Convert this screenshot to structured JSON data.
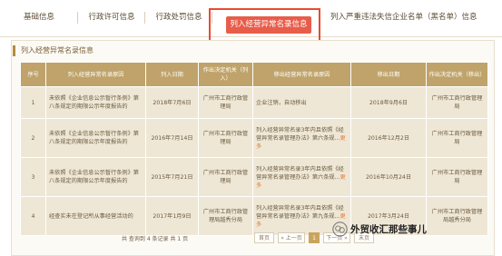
{
  "tabs": [
    {
      "label": "基础信息"
    },
    {
      "label": "行政许可信息"
    },
    {
      "label": "行政处罚信息"
    },
    {
      "label": "列入经营异常名录信息"
    },
    {
      "label": "列入严重违法失信企业名单（黑名单）信息"
    }
  ],
  "active_tab": 3,
  "section_title": "列入经营异常名录信息",
  "table": {
    "headers": [
      "序号",
      "列入经营异常名录原因",
      "列入日期",
      "作出决定机关（列入）",
      "移出经营异常名录原因",
      "移出日期",
      "作出决定机关（移出）"
    ],
    "rows": [
      {
        "no": "1",
        "reason": "未依照《企业信息公示暂行条例》第八条规定的期限公示年度报告的",
        "date": "2018年7月6日",
        "org": "广州市工商行政管理局",
        "out_reason": "企业注销，自动移出",
        "out_more": "",
        "out_date": "2018年9月6日",
        "out_org": "广州市工商行政管理局"
      },
      {
        "no": "2",
        "reason": "未依照《企业信息公示暂行条例》第八条规定的期限公示年度报告的",
        "date": "2016年7月14日",
        "org": "广州市工商行政管理局",
        "out_reason": "列入经营异常名录3年内且依照《经营异常名录管理办法》第六条规...",
        "out_more": "更多",
        "out_date": "2016年12月2日",
        "out_org": "广州市工商行政管理局"
      },
      {
        "no": "3",
        "reason": "未依照《企业信息公示暂行条例》第八条规定的期限公示年度报告的",
        "date": "2015年7月21日",
        "org": "广州市工商行政管理局",
        "out_reason": "列入经营异常名录3年内且依照《经营异常名录管理办法》第六条规...",
        "out_more": "更多",
        "out_date": "2016年10月24日",
        "out_org": "广州市工商行政管理局"
      },
      {
        "no": "4",
        "reason": "经查实未在登记所从事经营活动的",
        "date": "2017年1月9日",
        "org": "广州市工商行政管理局越秀分局",
        "out_reason": "列入经营异常名录3年内且依照《经营异常名录管理办法》第九条规...",
        "out_more": "更多",
        "out_date": "2017年3月24日",
        "out_org": "广州市工商行政管理局越秀分局"
      }
    ]
  },
  "pagination": {
    "total": "共 查询到 4 条记录 共 1 页",
    "first": "首页",
    "prev": "« 上一页",
    "current": "1",
    "next": "下一页 »",
    "last": "末页"
  },
  "watermark": "外贸收汇那些事儿"
}
